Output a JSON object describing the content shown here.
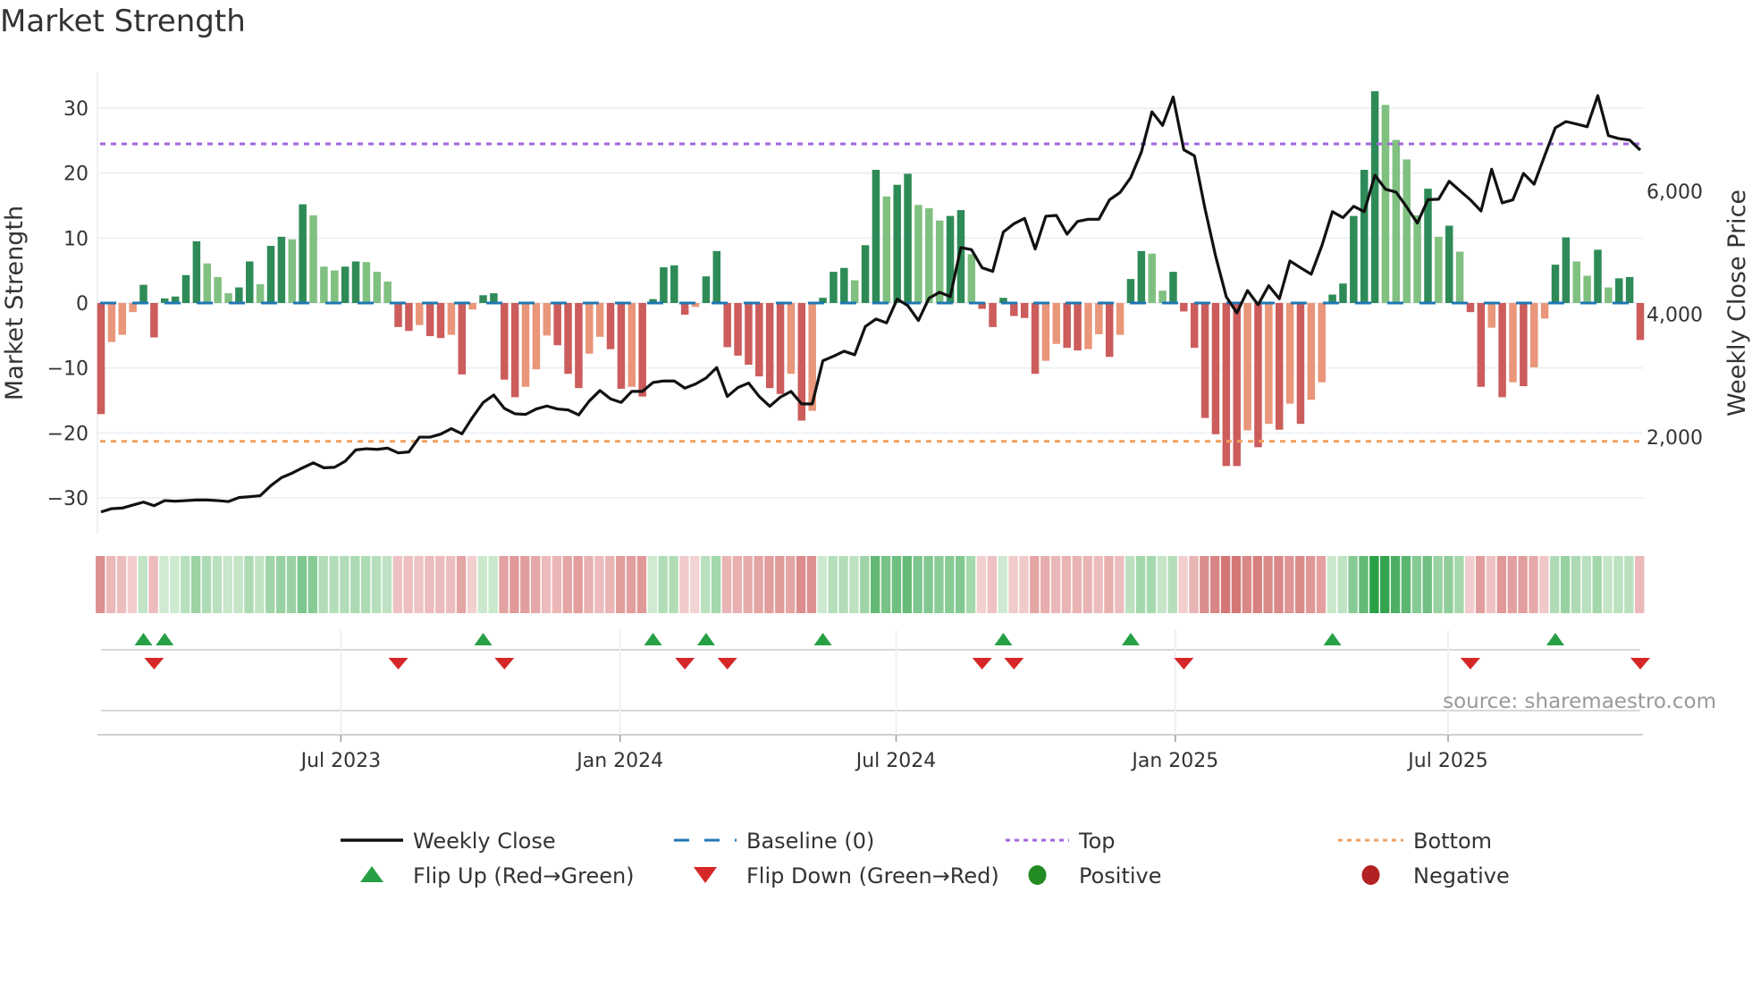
{
  "title": "Market Strength",
  "source": "source: sharemaestro.com",
  "colors": {
    "pos_dark": "#2e8b57",
    "pos_light": "#80c080",
    "neg_dark": "#cd5c5c",
    "neg_light": "#e9967a",
    "baseline": "#1f77b4",
    "top": "#a066dd",
    "bottom": "#f0a060",
    "close": "#111111",
    "flip_up": "#27a045",
    "flip_down": "#d62728",
    "positive": "#228b22",
    "negative": "#b22222"
  },
  "legend": [
    {
      "label": "Weekly Close",
      "kind": "line"
    },
    {
      "label": "Baseline (0)",
      "kind": "baseline"
    },
    {
      "label": "Top",
      "kind": "top"
    },
    {
      "label": "Bottom",
      "kind": "bottom"
    },
    {
      "label": "Flip Up (Red→Green)",
      "kind": "flip_up"
    },
    {
      "label": "Flip Down (Green→Red)",
      "kind": "flip_down"
    },
    {
      "label": "Positive",
      "kind": "positive"
    },
    {
      "label": "Negative",
      "kind": "negative"
    }
  ],
  "chart_data": {
    "type": "bar+line",
    "title": "Market Strength",
    "ylabel": "Market Strength",
    "y2label": "Weekly Close Price",
    "ylim": [
      -35.5,
      35.5
    ],
    "y2lim": [
      426,
      7931
    ],
    "yticks": [
      -30,
      -20,
      -10,
      0,
      10,
      20,
      30
    ],
    "y2ticks": [
      {
        "value": 2000,
        "label": "2,000"
      },
      {
        "value": 4000,
        "label": "4,000"
      },
      {
        "value": 6000,
        "label": "6,000"
      }
    ],
    "x_ticks": [
      {
        "label": "Jul 2023",
        "week": 22.6
      },
      {
        "label": "Jan 2024",
        "week": 48.9
      },
      {
        "label": "Jul 2024",
        "week": 74.9
      },
      {
        "label": "Jan 2025",
        "week": 101.2
      },
      {
        "label": "Jul 2025",
        "week": 126.9
      }
    ],
    "top_level": 24.5,
    "bottom_level": -21.3,
    "baseline": 0,
    "grid": true,
    "legend_position": "bottom",
    "strength": [
      -17.1,
      -6,
      -4.9,
      -1.4,
      2.8,
      -5.3,
      0.7,
      1,
      4.3,
      9.5,
      6.1,
      4,
      1.5,
      2.4,
      6.4,
      2.9,
      8.8,
      10.2,
      9.8,
      15.2,
      13.5,
      5.6,
      5,
      5.6,
      6.4,
      6.3,
      4.8,
      3.3,
      -3.7,
      -4.3,
      -3.4,
      -5.1,
      -5.4,
      -4.9,
      -11,
      -1,
      1.2,
      1.5,
      -11.8,
      -14.5,
      -12.9,
      -10.2,
      -5,
      -6.5,
      -10.9,
      -13.1,
      -7.8,
      -5.2,
      -7.1,
      -13.2,
      -12.9,
      -14.4,
      0.6,
      5.5,
      5.8,
      -1.8,
      -0.6,
      4.1,
      8,
      -6.8,
      -8.1,
      -9.5,
      -11.3,
      -13.1,
      -14,
      -10.9,
      -18.1,
      -16.6,
      0.8,
      4.8,
      5.4,
      3.5,
      8.9,
      20.5,
      16.4,
      18.2,
      19.9,
      15.1,
      14.6,
      12.7,
      13.4,
      14.3,
      7.5,
      -0.9,
      -3.7,
      0.8,
      -2,
      -2.3,
      -10.9,
      -8.9,
      -6.3,
      -6.9,
      -7.3,
      -7.1,
      -4.8,
      -8.3,
      -4.9,
      3.7,
      8,
      7.6,
      1.9,
      4.8,
      -1.3,
      -6.9,
      -17.7,
      -20.2,
      -25.1,
      -25.1,
      -19.6,
      -22.2,
      -18.6,
      -19.5,
      -15.5,
      -18.6,
      -14.9,
      -12.2,
      1.3,
      3,
      13.4,
      20.5,
      32.6,
      30.5,
      25.1,
      22.1,
      13.5,
      17.6,
      10.2,
      11.9,
      7.9,
      -1.4,
      -12.9,
      -3.8,
      -14.5,
      -12.2,
      -12.8,
      -9.9,
      -2.4,
      5.9,
      10.1,
      6.4,
      4.2,
      8.2,
      2.4,
      3.8,
      4,
      -5.7
    ],
    "close": [
      779,
      832,
      842,
      890,
      939,
      880,
      963,
      953,
      963,
      973,
      973,
      963,
      948,
      1013,
      1027,
      1043,
      1207,
      1337,
      1410,
      1497,
      1578,
      1497,
      1506,
      1603,
      1788,
      1807,
      1797,
      1817,
      1740,
      1755,
      1996,
      1996,
      2045,
      2134,
      2050,
      2318,
      2560,
      2681,
      2463,
      2376,
      2366,
      2454,
      2502,
      2454,
      2439,
      2357,
      2585,
      2754,
      2619,
      2560,
      2740,
      2740,
      2885,
      2910,
      2910,
      2793,
      2861,
      2958,
      3128,
      2658,
      2803,
      2876,
      2658,
      2498,
      2648,
      2740,
      2537,
      2537,
      3239,
      3312,
      3394,
      3336,
      3796,
      3918,
      3855,
      4242,
      4136,
      3894,
      4257,
      4354,
      4282,
      5081,
      5047,
      4752,
      4694,
      5333,
      5469,
      5556,
      5057,
      5590,
      5604,
      5299,
      5507,
      5541,
      5541,
      5857,
      5978,
      6220,
      6633,
      7290,
      7069,
      7530,
      6672,
      6575,
      5712,
      4939,
      4281,
      4018,
      4382,
      4150,
      4461,
      4247,
      4863,
      4752,
      4647,
      5108,
      5665,
      5568,
      5752,
      5665,
      6258,
      6030,
      5982,
      5739,
      5479,
      5860,
      5867,
      6160,
      6006,
      5857,
      5676,
      6355,
      5808,
      5857,
      6287,
      6112,
      6578,
      7030,
      7131,
      7091,
      7047,
      7553,
      6902,
      6854,
      6830,
      6667
    ]
  }
}
